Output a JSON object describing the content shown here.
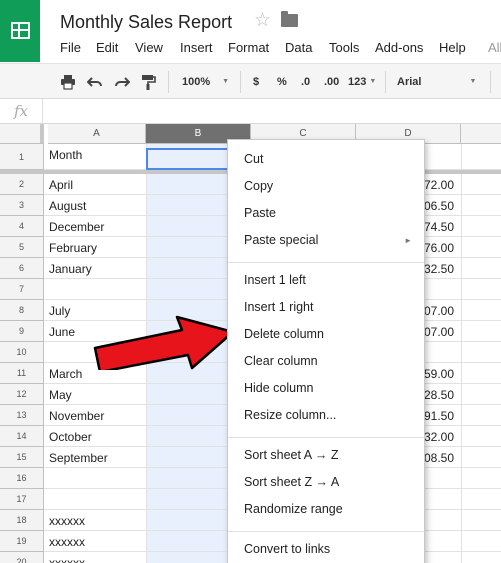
{
  "app": {
    "title": "Monthly Sales Report",
    "star_icon": "star-icon",
    "folder_icon": "folder-icon",
    "logo_icon": "sheets-logo-icon",
    "brand_color": "#0f9d58"
  },
  "menubar": [
    "File",
    "Edit",
    "View",
    "Insert",
    "Format",
    "Data",
    "Tools",
    "Add-ons",
    "Help",
    "All"
  ],
  "toolbar": {
    "print_icon": "print-icon",
    "undo_icon": "undo-icon",
    "redo_icon": "redo-icon",
    "paint_format_icon": "paint-format-icon",
    "zoom": "100%",
    "currency": "$",
    "percent": "%",
    "decrease_decimal": ".0",
    "increase_decimal": ".00",
    "more_formats": "123",
    "font": "Arial"
  },
  "formula_bar": {
    "label": "fx",
    "value": ""
  },
  "grid": {
    "columns": [
      "A",
      "B",
      "C",
      "D"
    ],
    "selected_column": "B",
    "selection_color": "#4d87e8",
    "rows": [
      {
        "num": "1",
        "a": "Month",
        "d": ""
      },
      {
        "num": "2",
        "a": "April",
        "d": "72.00"
      },
      {
        "num": "3",
        "a": "August",
        "d": "06.50"
      },
      {
        "num": "4",
        "a": "December",
        "d": "74.50"
      },
      {
        "num": "5",
        "a": "February",
        "d": "76.00"
      },
      {
        "num": "6",
        "a": "January",
        "d": "32.50"
      },
      {
        "num": "7",
        "a": "",
        "d": ""
      },
      {
        "num": "8",
        "a": "July",
        "d": "07.00"
      },
      {
        "num": "9",
        "a": "June",
        "d": "07.00"
      },
      {
        "num": "10",
        "a": "",
        "d": ""
      },
      {
        "num": "11",
        "a": "March",
        "d": "59.00"
      },
      {
        "num": "12",
        "a": "May",
        "d": "28.50"
      },
      {
        "num": "13",
        "a": "November",
        "d": "91.50"
      },
      {
        "num": "14",
        "a": "October",
        "d": "32.00"
      },
      {
        "num": "15",
        "a": "September",
        "d": "08.50"
      },
      {
        "num": "16",
        "a": "",
        "d": ""
      },
      {
        "num": "17",
        "a": "",
        "d": ""
      },
      {
        "num": "18",
        "a": "xxxxxx",
        "d": ""
      },
      {
        "num": "19",
        "a": "xxxxxx",
        "d": ""
      },
      {
        "num": "20",
        "a": "xxxxxx",
        "d": ""
      }
    ]
  },
  "context_menu": {
    "items": [
      {
        "label": "Cut"
      },
      {
        "label": "Copy"
      },
      {
        "label": "Paste"
      },
      {
        "label": "Paste special",
        "submenu": true
      },
      {
        "separator": true
      },
      {
        "label": "Insert 1 left"
      },
      {
        "label": "Insert 1 right"
      },
      {
        "label": "Delete column"
      },
      {
        "label": "Clear column"
      },
      {
        "label": "Hide column"
      },
      {
        "label": "Resize column..."
      },
      {
        "separator": true
      },
      {
        "label": "Sort sheet A → Z"
      },
      {
        "label": "Sort sheet Z → A"
      },
      {
        "label": "Randomize range"
      },
      {
        "separator": true
      },
      {
        "label": "Convert to links"
      }
    ]
  },
  "annotation": {
    "arrow_color": "#e8141b",
    "arrow_icon": "red-arrow-icon"
  }
}
